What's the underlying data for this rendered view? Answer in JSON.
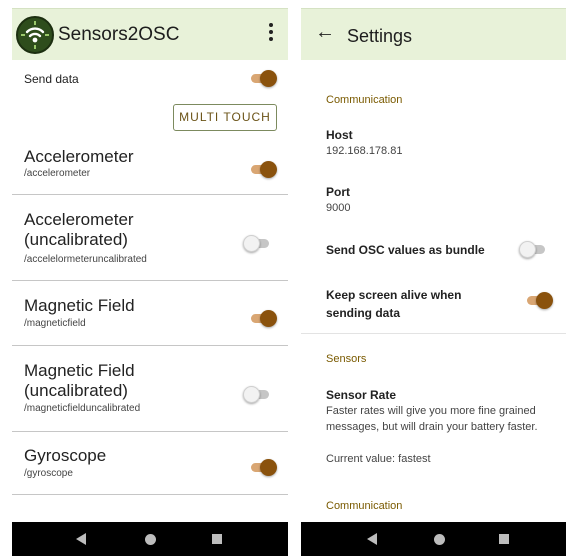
{
  "app": {
    "title": "Sensors2OSC",
    "send_data_label": "Send data",
    "send_data_on": true,
    "multi_touch_label": "MULTI TOUCH",
    "accent_color": "#8a520d",
    "appbar_color": "#e8f2d9"
  },
  "sensors": [
    {
      "name": "Accelerometer",
      "path": "/accelerometer",
      "enabled": true
    },
    {
      "name": "Accelerometer (uncalibrated)",
      "path": "/accelelormeteruncalibrated",
      "enabled": false
    },
    {
      "name": "Magnetic Field",
      "path": "/magneticfield",
      "enabled": true
    },
    {
      "name": "Magnetic Field (uncalibrated)",
      "path": "/magneticfielduncalibrated",
      "enabled": false
    },
    {
      "name": "Gyroscope",
      "path": "/gyroscope",
      "enabled": true
    }
  ],
  "settings": {
    "title": "Settings",
    "communication_header": "Communication",
    "host_label": "Host",
    "host_value": "192.168.178.81",
    "port_label": "Port",
    "port_value": "9000",
    "bundle_label": "Send OSC values as bundle",
    "bundle_on": false,
    "keep_alive_label": "Keep screen alive when sending data",
    "keep_alive_on": true,
    "sensors_header": "Sensors",
    "sensor_rate_label": "Sensor Rate",
    "sensor_rate_desc": "Faster rates will give you more fine grained messages, but will drain your battery faster.",
    "current_value": "Current value: fastest",
    "communication_header_2": "Communication"
  },
  "icons": {
    "overflow": "more-vert-icon",
    "back": "arrow-back-icon",
    "logo": "wifi-broadcast-logo",
    "nav_back": "nav-back-triangle-icon",
    "nav_home": "nav-home-circle-icon",
    "nav_recent": "nav-recents-square-icon"
  }
}
